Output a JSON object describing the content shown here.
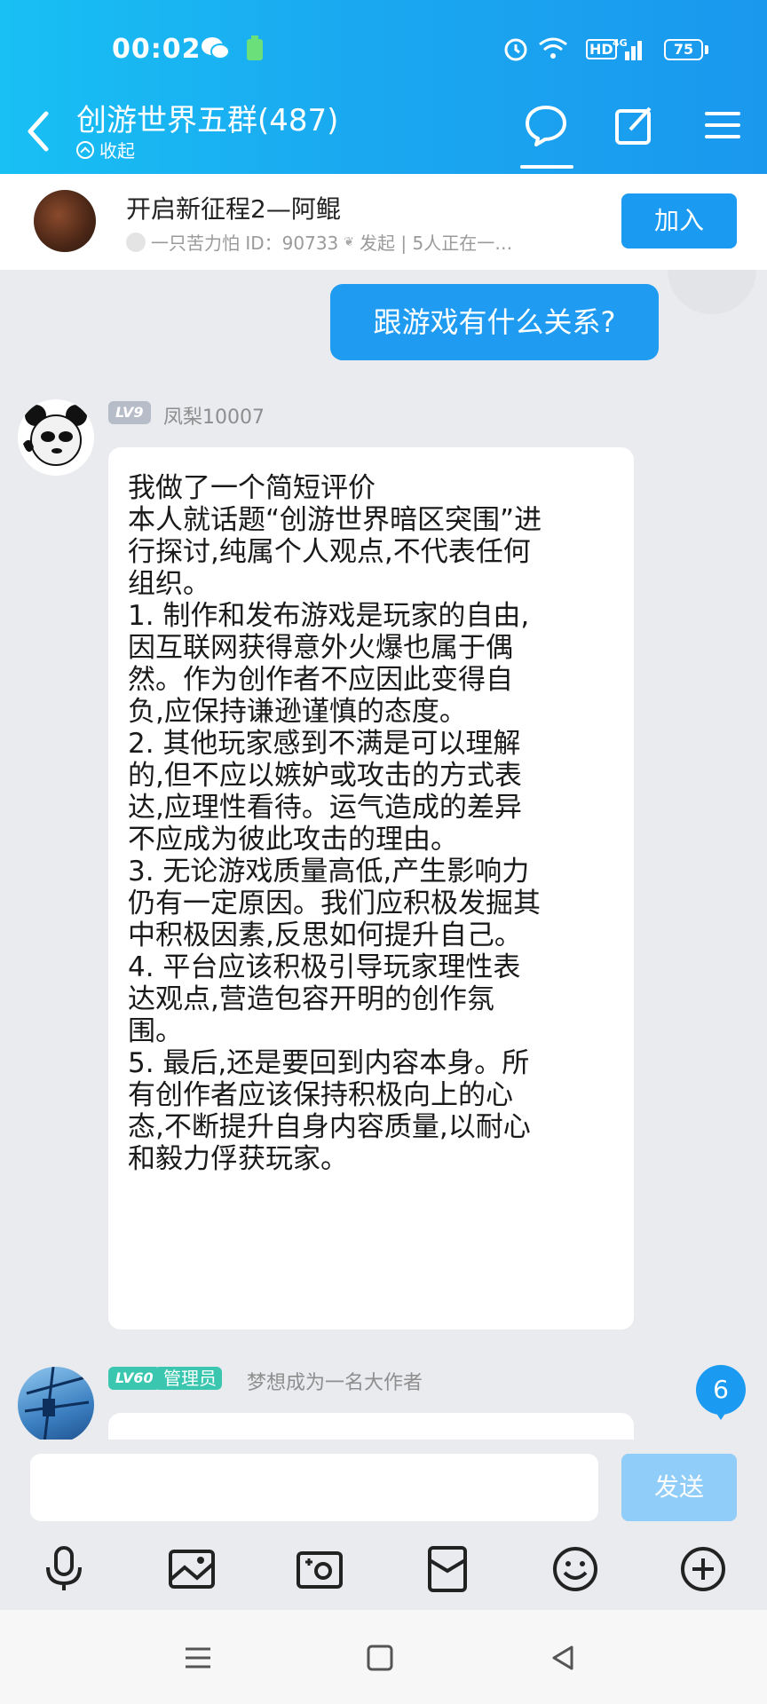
{
  "status": {
    "time": "00:02",
    "battery": "75",
    "network": "4G",
    "hd": "HD"
  },
  "header": {
    "title": "创游世界五群(487)",
    "collapse_label": "收起"
  },
  "banner": {
    "title": "开启新征程2—阿鲲",
    "subtitle_user": "一只苦力怕 ID：90733",
    "subtitle_rest": "发起 | 5人正在一…",
    "join_label": "加入"
  },
  "chat": {
    "my_message": "跟游戏有什么关系?",
    "msg1": {
      "level": "LV9",
      "username": "凤梨10007",
      "lines": [
        "我做了一个简短评价",
        "本人就话题“创游世界暗区突围”进",
        "行探讨,纯属个人观点,不代表任何",
        "组织。",
        "1. 制作和发布游戏是玩家的自由,",
        "因互联网获得意外火爆也属于偶",
        "然。作为创作者不应因此变得自",
        "负,应保持谦逊谨慎的态度。",
        "2. 其他玩家感到不满是可以理解",
        "的,但不应以嫉妒或攻击的方式表",
        "达,应理性看待。运气造成的差异",
        "不应成为彼此攻击的理由。",
        "3. 无论游戏质量高低,产生影响力",
        "仍有一定原因。我们应积极发掘其",
        "中积极因素,反思如何提升自己。",
        "4. 平台应该积极引导玩家理性表",
        "达观点,营造包容开明的创作氛",
        "围。",
        "5. 最后,还是要回到内容本身。所",
        "有创作者应该保持积极向上的心",
        "态,不断提升自身内容质量,以耐心",
        "和毅力俘获玩家。"
      ]
    },
    "msg2": {
      "level": "LV60",
      "role": "管理员",
      "username": "梦想成为一名大作者"
    },
    "unread_count": "6"
  },
  "input": {
    "placeholder": "",
    "send_label": "发送"
  },
  "toolbar": [
    "mic-icon",
    "image-icon",
    "camera-icon",
    "red-packet-icon",
    "emoji-icon",
    "plus-icon"
  ],
  "colors": {
    "header": "#1aa9f0",
    "accent": "#1a9af0",
    "send_disabled": "#90cdf8",
    "admin_badge": "#3bc6b0"
  }
}
